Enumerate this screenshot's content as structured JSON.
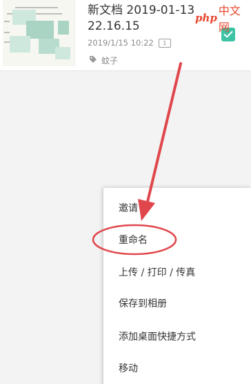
{
  "document": {
    "title": "新文档 2019-01-13 22.16.15",
    "date": "2019/1/15 10:22",
    "page_count": "1",
    "tag": "蚊子",
    "selected": true,
    "thumbnail": "blurred-document-preview"
  },
  "watermark": {
    "php": "php",
    "cn": "中文网"
  },
  "context_menu": {
    "items": [
      {
        "label": "邀请"
      },
      {
        "label": "重命名"
      },
      {
        "label": "上传 / 打印 / 传真"
      },
      {
        "label": "保存到相册"
      },
      {
        "label": "添加桌面快捷方式"
      },
      {
        "label": "移动"
      }
    ]
  },
  "annotation": {
    "highlighted_item": "重命名",
    "color": "#e0474c"
  },
  "colors": {
    "checkbox": "#3cc2a5",
    "annotation": "#e0474c",
    "watermark": "#e8462c"
  }
}
